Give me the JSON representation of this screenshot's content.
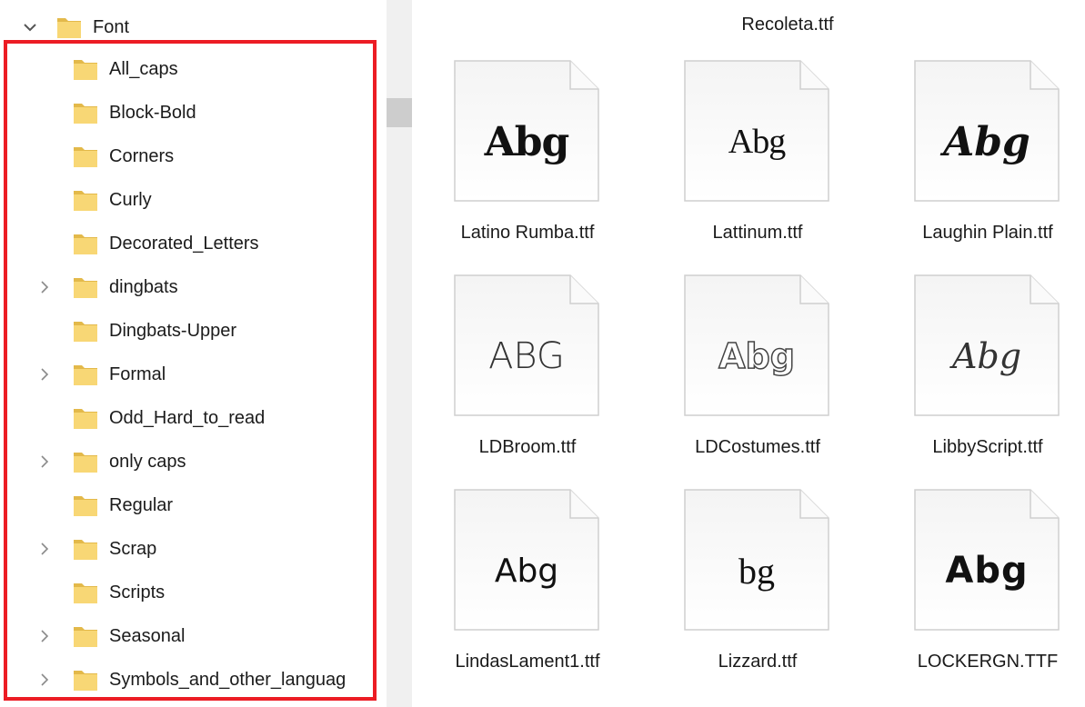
{
  "tree": {
    "root": {
      "label": "Font",
      "expanded": true
    },
    "items": [
      {
        "label": "All_caps",
        "has_children": false
      },
      {
        "label": "Block-Bold",
        "has_children": false
      },
      {
        "label": "Corners",
        "has_children": false
      },
      {
        "label": "Curly",
        "has_children": false
      },
      {
        "label": "Decorated_Letters",
        "has_children": false
      },
      {
        "label": "dingbats",
        "has_children": true
      },
      {
        "label": "Dingbats-Upper",
        "has_children": false
      },
      {
        "label": "Formal",
        "has_children": true
      },
      {
        "label": "Odd_Hard_to_read",
        "has_children": false
      },
      {
        "label": "only caps",
        "has_children": true
      },
      {
        "label": "Regular",
        "has_children": false
      },
      {
        "label": "Scrap",
        "has_children": true
      },
      {
        "label": "Scripts",
        "has_children": false
      },
      {
        "label": "Seasonal",
        "has_children": true
      },
      {
        "label": "Symbols_and_other_languag",
        "has_children": true
      }
    ]
  },
  "files": {
    "top_partial_label": "Recoleta.ttf",
    "items": [
      {
        "name": "Latino Rumba.ttf",
        "preview": "Abg"
      },
      {
        "name": "Lattinum.ttf",
        "preview": "Abg"
      },
      {
        "name": "Laughin Plain.ttf",
        "preview": "Abg"
      },
      {
        "name": "LDBroom.ttf",
        "preview": "ABG"
      },
      {
        "name": "LDCostumes.ttf",
        "preview": "Abg"
      },
      {
        "name": "LibbyScript.ttf",
        "preview": "Abg"
      },
      {
        "name": "LindasLament1.ttf",
        "preview": "Abg"
      },
      {
        "name": "Lizzard.ttf",
        "preview": "bg"
      },
      {
        "name": "LOCKERGN.TTF",
        "preview": "Abg"
      }
    ]
  },
  "colors": {
    "highlight": "#ec1c24",
    "folder": "#f8d775",
    "folder_dark": "#e3b94a",
    "scrollbar_thumb": "#cdcdcd",
    "scrollbar_track": "#f0f0f0"
  },
  "icons": {
    "expanded": "chevron-down-icon",
    "collapsed": "chevron-right-icon",
    "folder": "folder-icon",
    "file": "font-file-icon"
  }
}
